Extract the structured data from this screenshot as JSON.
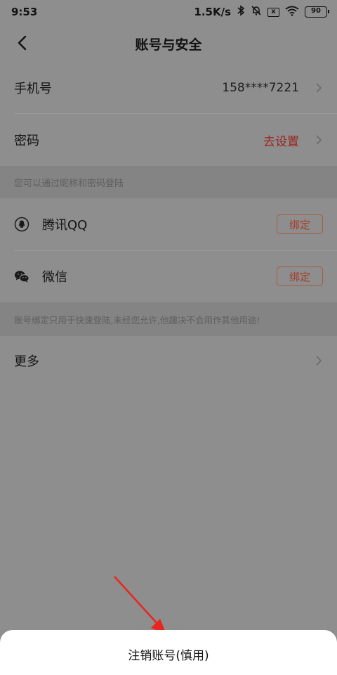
{
  "status_bar": {
    "time": "9:53",
    "net_speed": "1.5K/s",
    "bluetooth_icon": "bluetooth-icon",
    "mute_icon": "bell-off-icon",
    "box_icon_label": "x",
    "wifi_icon": "wifi-icon",
    "battery": "90"
  },
  "header": {
    "title": "账号与安全",
    "back_icon": "chevron-left-icon"
  },
  "account": {
    "phone_label": "手机号",
    "phone_value": "158****7221",
    "password_label": "密码",
    "password_value": "去设置"
  },
  "login_hint": "您可以通过昵称和密码登陆",
  "bindings": {
    "qq_label": "腾讯QQ",
    "qq_button": "绑定",
    "wechat_label": "微信",
    "wechat_button": "绑定"
  },
  "binding_hint": "账号绑定只用于快速登陆,未经您允许,他趣决不会用作其他用途!",
  "more_label": "更多",
  "bottom_sheet": {
    "delete_label": "注销账号(慎用)"
  },
  "colors": {
    "overlay_bg": "#8e8e8e",
    "accent_red": "#9b2420",
    "arrow_red": "#e8261f"
  }
}
